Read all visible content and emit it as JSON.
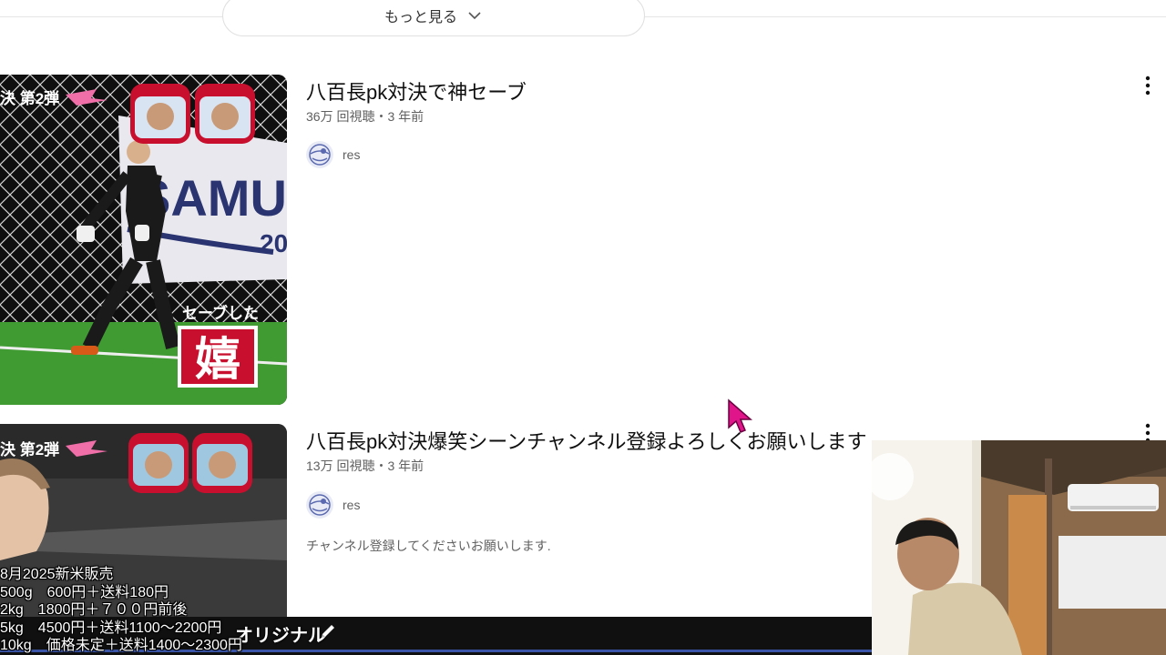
{
  "show_more": {
    "label": "もっと見る"
  },
  "videos": [
    {
      "title": "八百長pk対決で神セーブ",
      "meta": "36万 回視聴・3 年前",
      "channel": "res",
      "thumb_top_text": "決 第2弾",
      "thumb_overlay_small": "セーブした",
      "thumb_overlay_big": "嬉",
      "banner_text": "SAMU",
      "banner_year": "20"
    },
    {
      "title": "八百長pk対決爆笑シーンチャンネル登録よろしくお願いします",
      "meta": "13万 回視聴・3 年前",
      "channel": "res",
      "description": "チャンネル登録してくださいお願いします.",
      "thumb_top_text": "決 第2弾"
    }
  ],
  "stream_overlay": {
    "lines": [
      "8月2025新米販売",
      "500g　600円＋送料180円",
      "2kg　1800円＋７００円前後",
      "5kg　4500円＋送料1100〜2200円",
      "10kg　価格未定＋送料1400〜2300円"
    ],
    "original_label": "オリジナル"
  },
  "icons": {
    "show_more": "chevron-down-icon",
    "menu": "kebab-menu-icon",
    "cursor": "mouse-cursor-icon",
    "edit": "pencil-icon"
  },
  "colors": {
    "cursor": "#e0158a",
    "thumb_red": "#c8102e",
    "bottom_strip": "#3a55a8"
  }
}
